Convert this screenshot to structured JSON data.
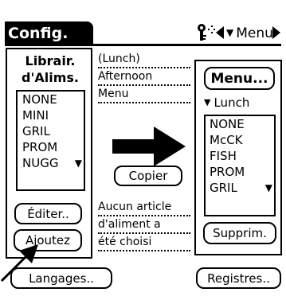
{
  "title_bar": {
    "title": "Config.",
    "menu_label": "Menu",
    "icons": [
      "key-icon",
      "left-arrow-icon",
      "dropdown-triangle-icon",
      "right-arrow-icon"
    ]
  },
  "left_panel": {
    "heading_line1": "Librair.",
    "heading_line2": "d'Alims.",
    "list": [
      "NONE",
      "MINI",
      "GRIL",
      "PROM",
      "NUGG"
    ],
    "scroll_icon": "scroll-down-arrow-icon",
    "edit_button": "Éditer..",
    "add_button": "Ajoutez"
  },
  "middle": {
    "lunch_link": "(Lunch)",
    "afternoon_link": "Afternoon",
    "menu_link": "Menu",
    "copy_button": "Copier",
    "message_line1": "Aucun article",
    "message_line2": "d'aliment a",
    "message_line3": "été choisi"
  },
  "right_panel": {
    "menu_button": "Menu...",
    "selector_value": "Lunch",
    "list": [
      "NONE",
      "McCK",
      "FISH",
      "PROM",
      "GRIL"
    ],
    "scroll_icon": "scroll-down-arrow-icon",
    "delete_button": "Supprim."
  },
  "bottom": {
    "languages_button": "Langages..",
    "records_button": "Registres.."
  },
  "colors": {
    "foreground": "#000000",
    "background": "#ffffff"
  }
}
